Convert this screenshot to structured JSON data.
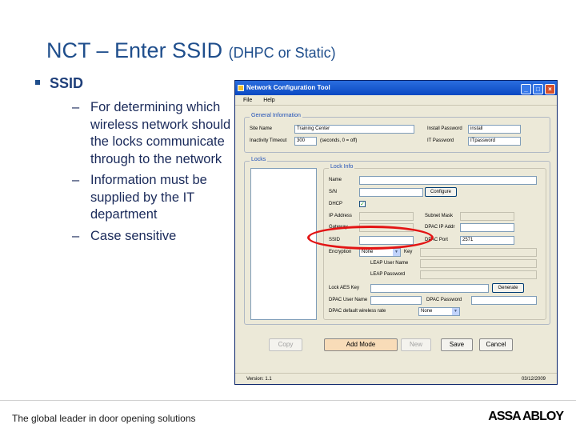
{
  "slide": {
    "title_main": "NCT – Enter SSID",
    "title_sub": "(DHPC or Static)",
    "bullet": "SSID",
    "sub_bullets": [
      "For determining which wireless network should the locks communicate through to the network",
      "Information must be supplied by the IT department",
      "Case sensitive"
    ],
    "dash": "–"
  },
  "window": {
    "title": "Network Configuration Tool",
    "menu": [
      "File",
      "Help"
    ],
    "general": {
      "label": "General Information",
      "site_name_label": "Site Name",
      "site_name_value": "Training Center",
      "inactivity_label": "Inactivity Timeout",
      "inactivity_value": "300",
      "inactivity_hint": "(seconds, 0 = off)",
      "install_pw_label": "Install Password",
      "install_pw_value": "install",
      "it_pw_label": "IT Password",
      "it_pw_value": "ITpassword"
    },
    "locks": {
      "label": "Locks",
      "info_label": "Lock Info",
      "name_label": "Name",
      "sn_label": "S/N",
      "configure_label": "Configure",
      "dhcp_label": "DHCP",
      "dhcp_checked": "✓",
      "ip_label": "IP Address",
      "subnet_label": "Subnet Mask",
      "gateway_label": "Gateway",
      "dpac_ip_label": "DPAC IP Addr",
      "ssid_label": "SSID",
      "dpac_port_label": "DPAC Port",
      "dpac_port_value": "2571",
      "encryption_label": "Encryption",
      "encryption_value": "None",
      "key_label": "Key",
      "leap_user_label": "LEAP User Name",
      "leap_pw_label": "LEAP Password",
      "lock_aes_label": "Lock AES Key",
      "generate_label": "Generate",
      "dpac_user_label": "DPAC User Name",
      "dpac_pw_label": "DPAC Password",
      "dpac_rate_label": "DPAC default wireless rate",
      "dpac_rate_value": "None"
    },
    "buttons": {
      "copy": "Copy",
      "add_mode": "Add Mode",
      "new": "New",
      "save": "Save",
      "cancel": "Cancel"
    },
    "status": {
      "version": "Version: 1.1",
      "date": "03/12/2009"
    }
  },
  "footer": {
    "tagline": "The global leader in door opening solutions",
    "logo": "ASSA ABLOY"
  },
  "colors": {
    "title": "#1f4e8c",
    "highlight": "#e31414",
    "titlebar": "#0a49c2"
  }
}
